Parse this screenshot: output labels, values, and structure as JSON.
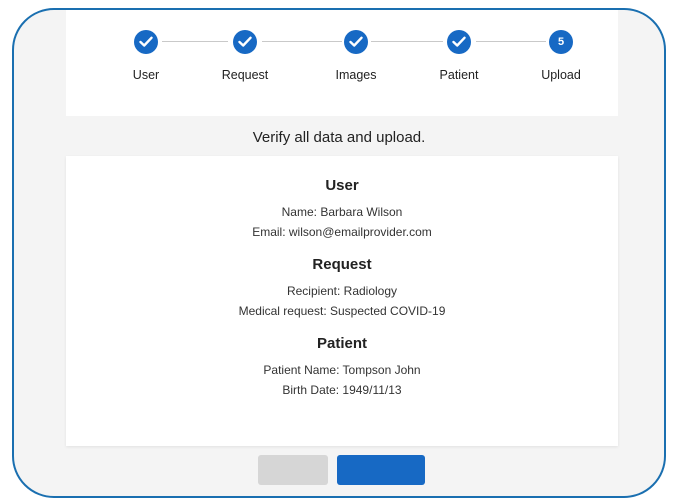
{
  "stepper": {
    "steps": [
      {
        "label": "User",
        "state": "done"
      },
      {
        "label": "Request",
        "state": "done"
      },
      {
        "label": "Images",
        "state": "done"
      },
      {
        "label": "Patient",
        "state": "done"
      },
      {
        "label": "Upload",
        "state": "active",
        "number": "5"
      }
    ]
  },
  "instruction": "Verify all data and upload.",
  "summary": {
    "user": {
      "title": "User",
      "name": "Name: Barbara Wilson",
      "email": "Email: wilson@emailprovider.com"
    },
    "request": {
      "title": "Request",
      "recipient": "Recipient: Radiology",
      "medical": "Medical request: Suspected COVID-19"
    },
    "patient": {
      "title": "Patient",
      "name": "Patient Name: Tompson John",
      "birth": "Birth Date: 1949/11/13"
    }
  },
  "colors": {
    "accent": "#1769c4",
    "frame": "#1a6fb0",
    "secondary_button": "#d6d6d6"
  }
}
